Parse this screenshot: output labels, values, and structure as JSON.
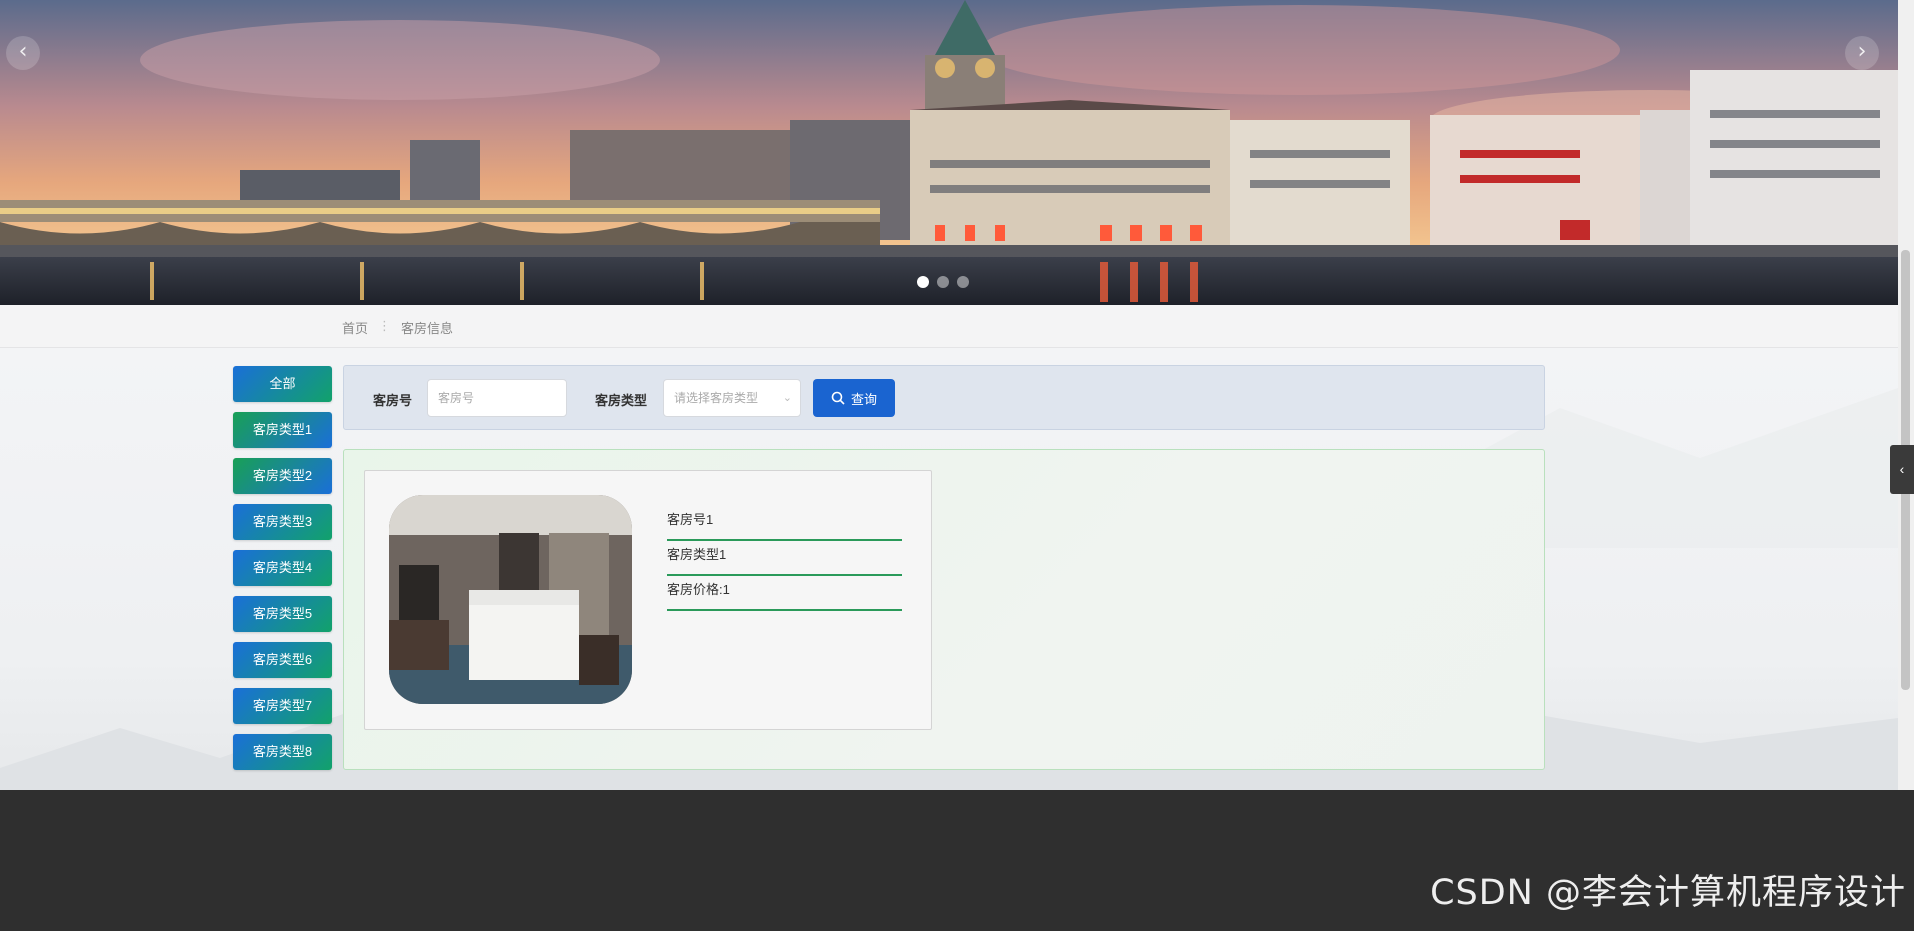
{
  "banner": {
    "image_name": "city-riverside-sunset-photo",
    "prev_icon": "‹",
    "next_icon": "›",
    "slide_count": 3,
    "active_slide": 0
  },
  "breadcrumb": {
    "home": "首页",
    "separator": "⋮",
    "current": "客房信息"
  },
  "categories": [
    {
      "label": "全部"
    },
    {
      "label": "客房类型1"
    },
    {
      "label": "客房类型2"
    },
    {
      "label": "客房类型3"
    },
    {
      "label": "客房类型4"
    },
    {
      "label": "客房类型5"
    },
    {
      "label": "客房类型6"
    },
    {
      "label": "客房类型7"
    },
    {
      "label": "客房类型8"
    }
  ],
  "search": {
    "room_no_label": "客房号",
    "room_no_placeholder": "客房号",
    "room_type_label": "客房类型",
    "room_type_placeholder": "请选择客房类型",
    "button_label": "查询",
    "button_icon": "search-icon"
  },
  "rooms": [
    {
      "image": "hotel-room-bed-photo",
      "room_no": "客房号1",
      "room_type": "客房类型1",
      "price": "客房价格:1"
    }
  ],
  "side_tab_icon": "‹",
  "watermark": "CSDN @李会计算机程序设计",
  "colors": {
    "primary_blue": "#1a64d0",
    "accent_green": "#12a26a",
    "footer": "#2f2f2f"
  }
}
